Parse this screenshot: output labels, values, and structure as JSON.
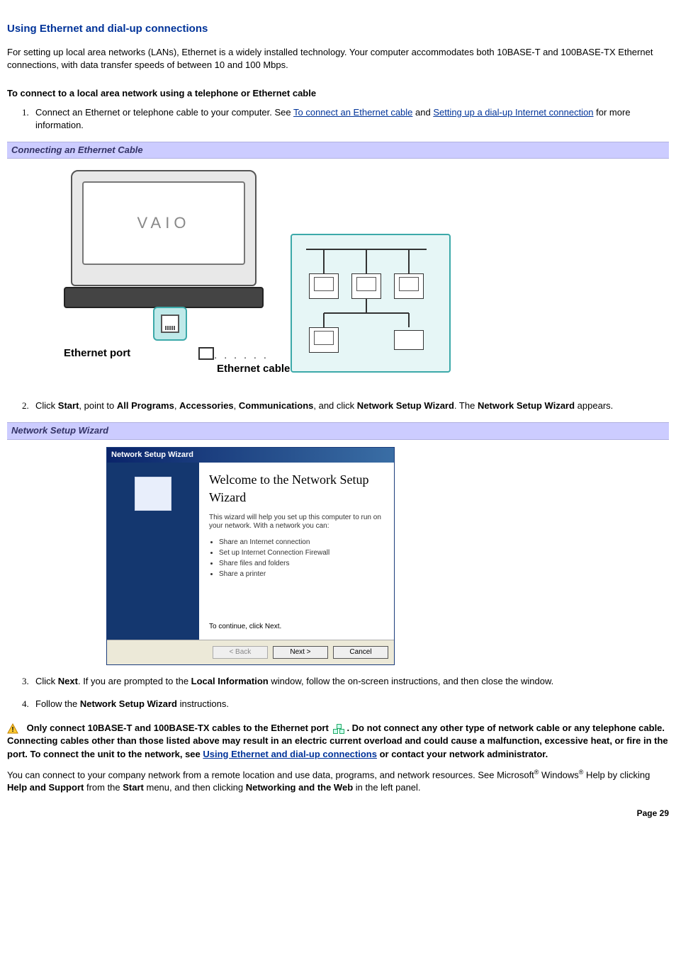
{
  "section_title": "Using Ethernet and dial-up connections",
  "intro": "For setting up local area networks (LANs), Ethernet is a widely installed technology. Your computer accommodates both 10BASE-T and 100BASE-TX Ethernet connections, with data transfer speeds of between 10 and 100 Mbps.",
  "subheading": "To connect to a local area network using a telephone or Ethernet cable",
  "step1_pre": "Connect an Ethernet or telephone cable to your computer. See ",
  "step1_link1": "To connect an Ethernet cable",
  "step1_mid": " and ",
  "step1_link2": "Setting up a dial-up Internet connection",
  "step1_post": " for more information.",
  "caption1": "Connecting an Ethernet Cable",
  "eth_labels": {
    "port": "Ethernet port",
    "cable": "Ethernet cable",
    "brand": "VAIO"
  },
  "step2": {
    "pre": "Click ",
    "b1": "Start",
    "m1": ", point to ",
    "b2": "All Programs",
    "m2": ", ",
    "b3": "Accessories",
    "m3": ", ",
    "b4": "Communications",
    "m4": ", and click ",
    "b5": "Network Setup Wizard",
    "m5": ". The ",
    "b6": "Network Setup Wizard",
    "post": " appears."
  },
  "caption2": "Network Setup Wizard",
  "wizard": {
    "title": "Network Setup Wizard",
    "welcome": "Welcome to the Network Setup Wizard",
    "desc": "This wizard will help you set up this computer to run on your network. With a network you can:",
    "bullets": [
      "Share an Internet connection",
      "Set up Internet Connection Firewall",
      "Share files and folders",
      "Share a printer"
    ],
    "continue": "To continue, click Next.",
    "btn_back": "< Back",
    "btn_next": "Next >",
    "btn_cancel": "Cancel"
  },
  "step3": {
    "pre": "Click ",
    "b1": "Next",
    "m1": ". If you are prompted to the ",
    "b2": "Local Information",
    "post": " window, follow the on-screen instructions, and then close the window."
  },
  "step4": {
    "pre": "Follow the ",
    "b1": "Network Setup Wizard",
    "post": " instructions."
  },
  "warning": {
    "p1a": "Only connect 10BASE-T and 100BASE-TX cables to the Ethernet port ",
    "p1b": ". Do not connect any other type of network cable or any telephone cable. Connecting cables other than those listed above may result in an electric current overload and could cause a malfunction, excessive heat, or fire in the port. To connect the unit to the network, see ",
    "link": "Using Ethernet and dial-up connections",
    "p1c": " or contact your network administrator."
  },
  "closing": {
    "p1": "You can connect to your company network from a remote location and use data, programs, and network resources. See Microsoft",
    "reg1": "®",
    "p2": " Windows",
    "reg2": "®",
    "p3": " Help by clicking ",
    "b1": "Help and Support",
    "p4": " from the ",
    "b2": "Start",
    "p5": " menu, and then clicking ",
    "b3": "Networking and the Web",
    "p6": " in the left panel."
  },
  "page_number": "Page 29"
}
